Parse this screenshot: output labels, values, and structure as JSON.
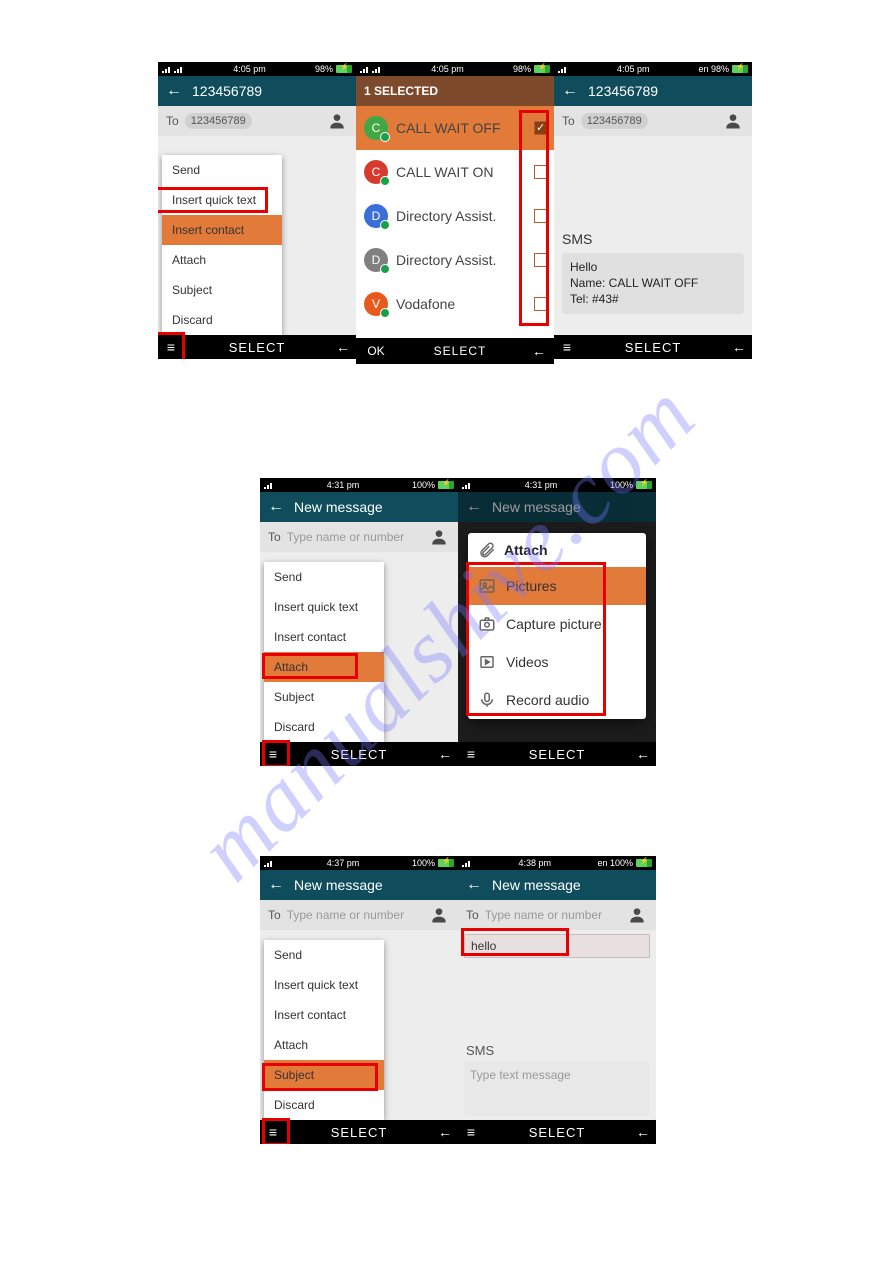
{
  "watermark": "manualshive.com",
  "row1": {
    "a": {
      "status": {
        "time": "4:05 pm",
        "batt": "98%"
      },
      "header_title": "123456789",
      "to_label": "To",
      "to_chip": "123456789",
      "menu": [
        "Send",
        "Insert quick text",
        "Insert contact",
        "Attach",
        "Subject",
        "Discard"
      ],
      "soft_mid": "SELECT"
    },
    "b": {
      "status": {
        "time": "4:05 pm",
        "batt": "98%"
      },
      "sel_header": "1 SELECTED",
      "rows": [
        {
          "name": "CALL WAIT OFF",
          "color": "#3fa845",
          "checked": true,
          "letter": "C"
        },
        {
          "name": "CALL WAIT ON",
          "color": "#d83a2e",
          "checked": false,
          "letter": "C"
        },
        {
          "name": "Directory Assist.",
          "color": "#3a6fd8",
          "checked": false,
          "letter": "D"
        },
        {
          "name": "Directory Assist.",
          "color": "#808080",
          "checked": false,
          "letter": "D"
        },
        {
          "name": "Vodafone",
          "color": "#e65a1e",
          "checked": false,
          "letter": "V"
        }
      ],
      "soft_ok": "OK",
      "soft_mid": "SELECT"
    },
    "c": {
      "status": {
        "time": "4:05 pm",
        "batt": "en 98%"
      },
      "header_title": "123456789",
      "to_label": "To",
      "to_chip": "123456789",
      "sms_label": "SMS",
      "sms_line1": "Hello",
      "sms_line2": "Name: CALL WAIT OFF",
      "sms_line3": "Tel: #43#",
      "soft_mid": "SELECT"
    }
  },
  "row2": {
    "a": {
      "status": {
        "time": "4:31 pm",
        "batt": "100%"
      },
      "header_title": "New message",
      "to_label": "To",
      "to_placeholder": "Type name or number",
      "menu": [
        "Send",
        "Insert quick text",
        "Insert contact",
        "Attach",
        "Subject",
        "Discard"
      ],
      "soft_mid": "SELECT"
    },
    "b": {
      "status": {
        "time": "4:31 pm",
        "batt": "100%"
      },
      "header_title": "New message",
      "attach_head": "Attach",
      "attach_rows": [
        "Pictures",
        "Capture picture",
        "Videos",
        "Record audio"
      ],
      "soft_mid": "SELECT"
    }
  },
  "row3": {
    "a": {
      "status": {
        "time": "4:37 pm",
        "batt": "100%"
      },
      "header_title": "New message",
      "to_label": "To",
      "to_placeholder": "Type name or number",
      "menu": [
        "Send",
        "Insert quick text",
        "Insert contact",
        "Attach",
        "Subject",
        "Discard"
      ],
      "soft_mid": "SELECT"
    },
    "b": {
      "status": {
        "time": "4:38 pm",
        "batt": "en 100%"
      },
      "header_title": "New message",
      "to_label": "To",
      "to_placeholder": "Type name or number",
      "subject_value": "hello",
      "sms_label": "SMS",
      "msg_placeholder": "Type text message",
      "soft_mid": "SELECT"
    }
  }
}
